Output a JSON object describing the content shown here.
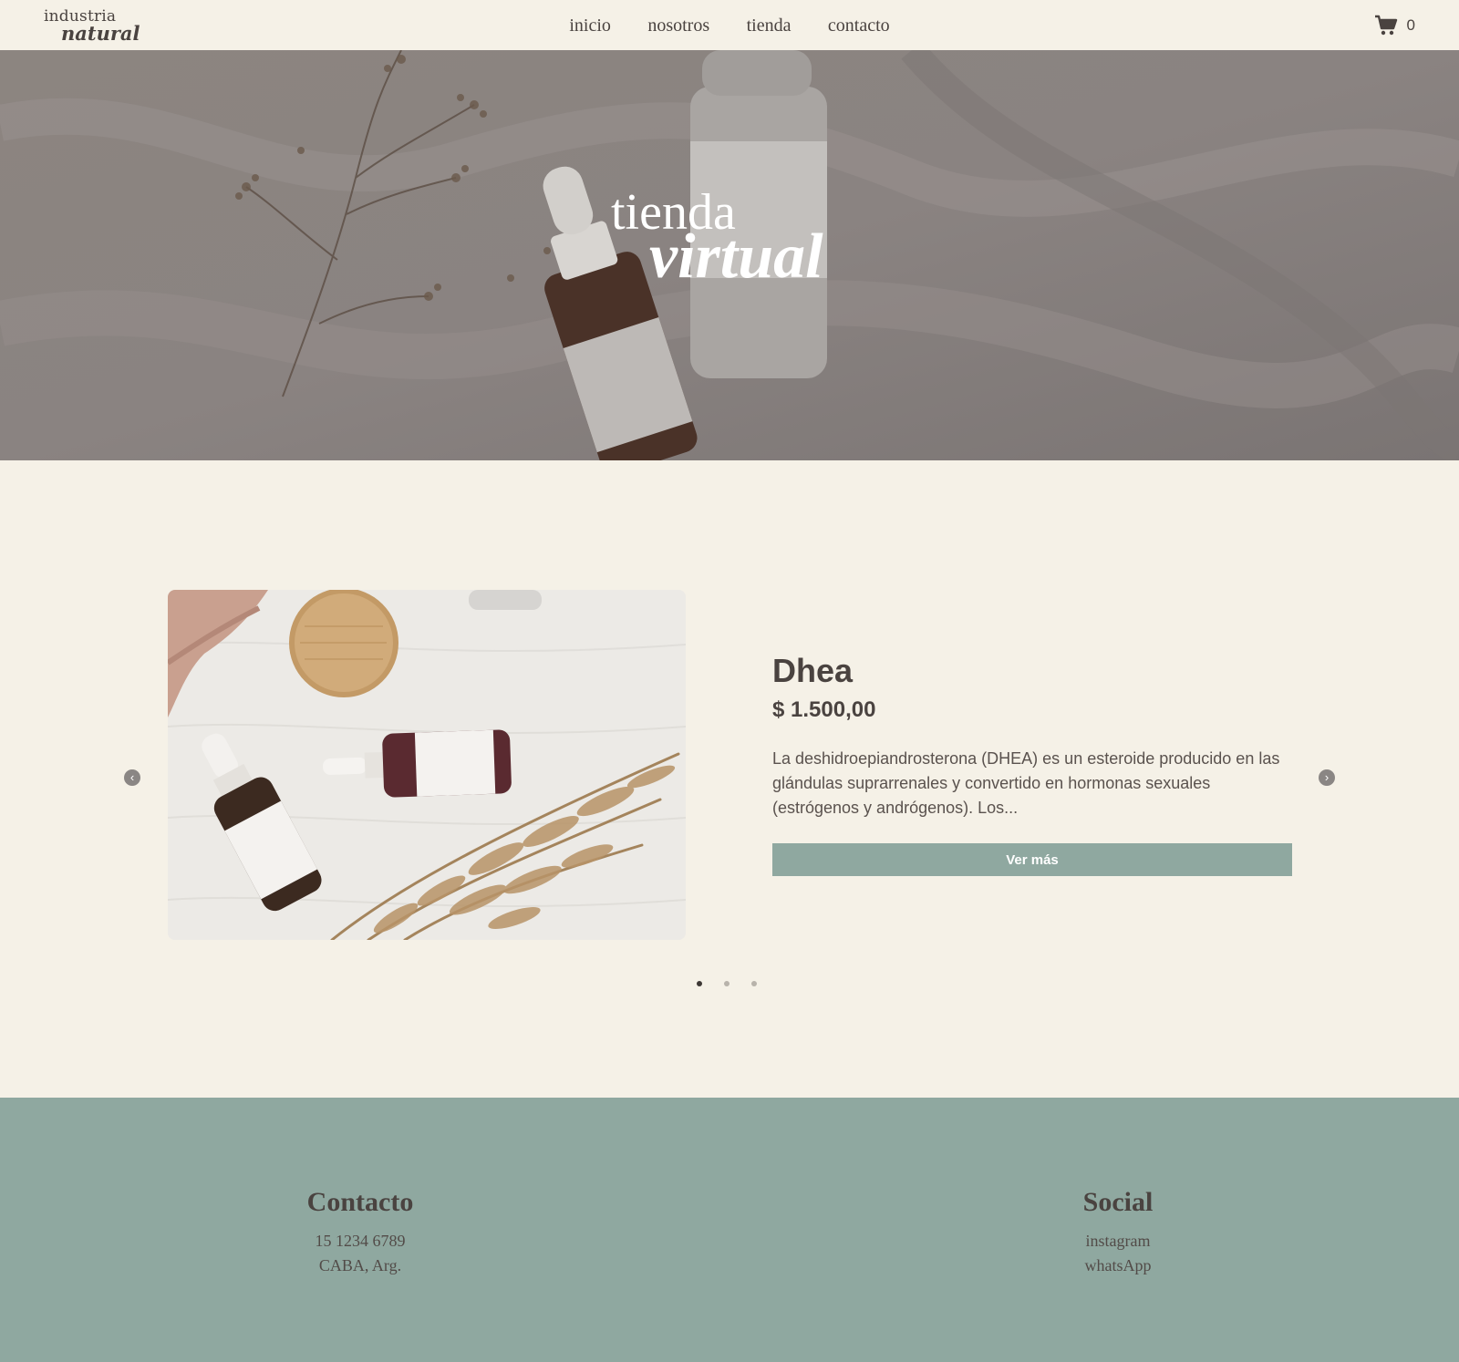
{
  "nav": {
    "logo_line1": "industria",
    "logo_line2": "natural",
    "links": [
      "inicio",
      "nosotros",
      "tienda",
      "contacto"
    ],
    "cart_icon": "cart-icon",
    "cart_count": "0"
  },
  "hero": {
    "title_line1": "tienda",
    "title_line2": "virtual"
  },
  "product": {
    "name": "Dhea",
    "price": "$ 1.500,00",
    "description": "La deshidroepiandrosterona (DHEA) es un esteroide producido en las glándulas suprarrenales y convertido en hormonas sexuales (estrógenos y andrógenos). Los...",
    "button_label": "Ver más"
  },
  "carousel": {
    "prev_icon": "chevron-left-icon",
    "next_icon": "chevron-right-icon",
    "slides": 3,
    "active_slide": 1
  },
  "footer": {
    "contact_title": "Contacto",
    "phone": "15 1234 6789",
    "location": "CABA, Arg.",
    "social_title": "Social",
    "instagram": "instagram",
    "whatsapp": "whatsApp"
  },
  "colors": {
    "background": "#f5f1e7",
    "accent": "#8fa8a0",
    "text": "#4a4340"
  }
}
